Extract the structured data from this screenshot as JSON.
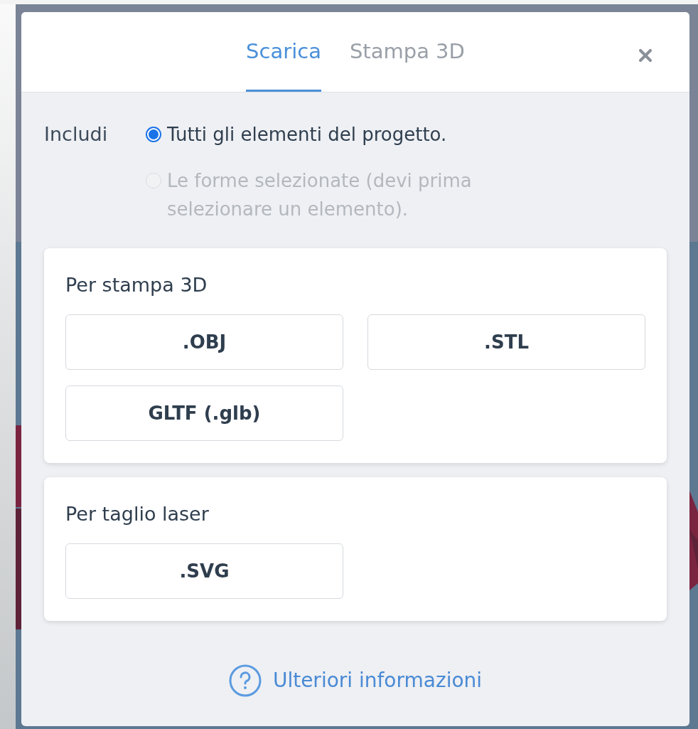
{
  "tabs": [
    {
      "label": "Scarica",
      "selected": true
    },
    {
      "label": "Stampa 3D",
      "selected": false
    }
  ],
  "include": {
    "label": "Includi",
    "options": [
      {
        "label": "Tutti gli elementi del progetto.",
        "selected": true,
        "disabled": false
      },
      {
        "label": "Le forme selezionate (devi prima selezionare un elemento).",
        "selected": false,
        "disabled": true
      }
    ]
  },
  "sections": [
    {
      "title": "Per stampa 3D",
      "buttons": [
        ".OBJ",
        ".STL",
        "GLTF (.glb)"
      ]
    },
    {
      "title": "Per taglio laser",
      "buttons": [
        ".SVG"
      ]
    }
  ],
  "help_link": "Ulteriori informazioni"
}
